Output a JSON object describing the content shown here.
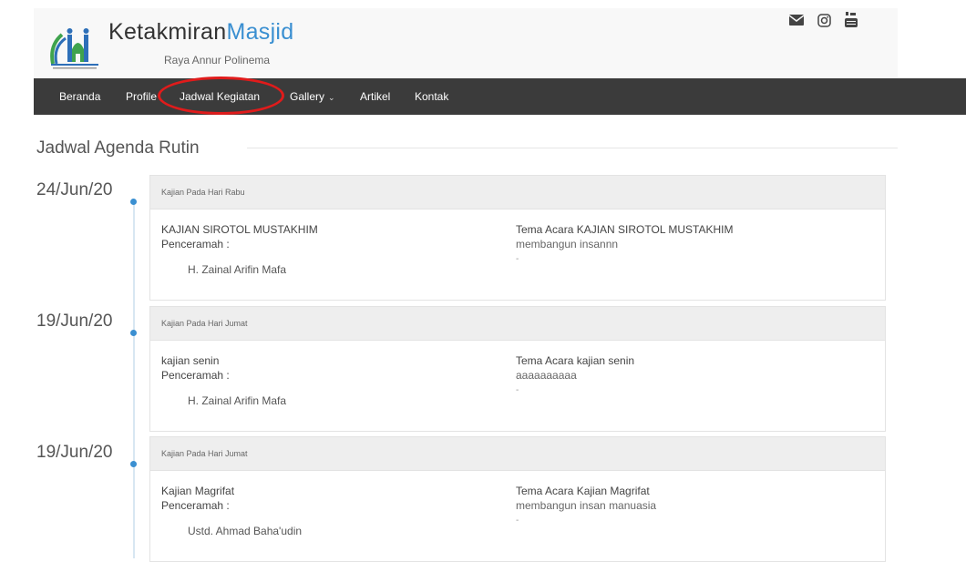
{
  "header": {
    "title_plain": "Ketakmiran",
    "title_accent": "Masjid",
    "subtitle": "Raya Annur Polinema",
    "social": [
      {
        "icon": "envelope-icon"
      },
      {
        "icon": "instagram-icon"
      },
      {
        "icon": "youtube-icon"
      }
    ]
  },
  "nav": {
    "items": [
      {
        "label": "Beranda"
      },
      {
        "label": "Profile"
      },
      {
        "label": "Jadwal Kegiatan"
      },
      {
        "label": "Gallery"
      },
      {
        "label": "Artikel"
      },
      {
        "label": "Kontak"
      }
    ],
    "highlighted": "Jadwal Kegiatan",
    "highlight_color": "#e01b1b"
  },
  "section": {
    "title": "Jadwal Agenda Rutin"
  },
  "colors": {
    "accent": "#3a8fd1",
    "nav_bg": "#3b3b3b"
  },
  "events": [
    {
      "date": "24/Jun/20",
      "header": "Kajian Pada Hari Rabu",
      "title": "KAJIAN SIROTOL MUSTAKHIM",
      "speaker_label": "Penceramah :",
      "speaker": "H. Zainal Arifin Mafa",
      "theme": "Tema Acara KAJIAN SIROTOL MUSTAKHIM",
      "description": "membangun insannn",
      "note": "-"
    },
    {
      "date": "19/Jun/20",
      "header": "Kajian Pada Hari Jumat",
      "title": "kajian senin",
      "speaker_label": "Penceramah :",
      "speaker": "H. Zainal Arifin Mafa",
      "theme": "Tema Acara kajian senin",
      "description": "aaaaaaaaaa",
      "note": "-"
    },
    {
      "date": "19/Jun/20",
      "header": "Kajian Pada Hari Jumat",
      "title": "Kajian Magrifat",
      "speaker_label": "Penceramah :",
      "speaker": "Ustd. Ahmad Baha'udin",
      "theme": "Tema Acara Kajian Magrifat",
      "description": "membangun insan manuasia",
      "note": "-"
    }
  ]
}
